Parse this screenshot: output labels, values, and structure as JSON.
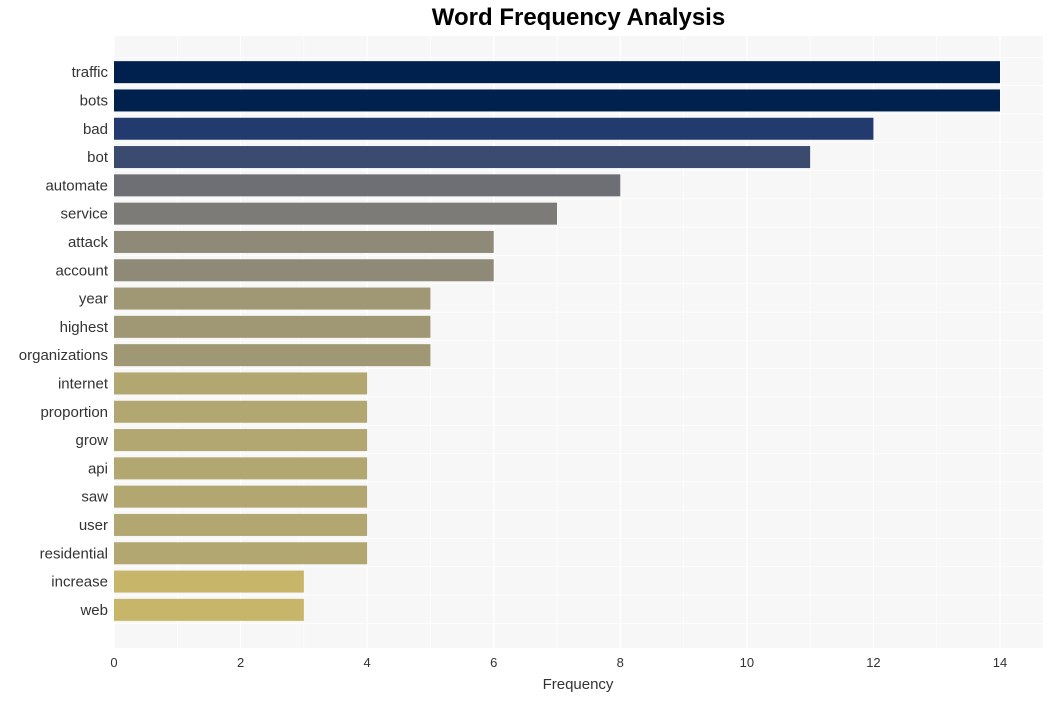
{
  "chart_data": {
    "type": "bar",
    "orientation": "horizontal",
    "title": "Word Frequency Analysis",
    "xlabel": "Frequency",
    "ylabel": "",
    "xlim": [
      0,
      14.7
    ],
    "xticks": [
      0,
      2,
      4,
      6,
      8,
      10,
      12,
      14
    ],
    "grid": true,
    "legend": "none",
    "categories": [
      "traffic",
      "bots",
      "bad",
      "bot",
      "automate",
      "service",
      "attack",
      "account",
      "year",
      "highest",
      "organizations",
      "internet",
      "proportion",
      "grow",
      "api",
      "saw",
      "user",
      "residential",
      "increase",
      "web"
    ],
    "values": [
      14,
      14,
      12,
      11,
      8,
      7,
      6,
      6,
      5,
      5,
      5,
      4,
      4,
      4,
      4,
      4,
      4,
      4,
      3,
      3
    ],
    "colors": [
      "#00204e",
      "#00204e",
      "#233a6e",
      "#3b4a6f",
      "#6d6f75",
      "#7d7b78",
      "#8f8a78",
      "#8f8a78",
      "#a09775",
      "#a09775",
      "#a09775",
      "#b2a671",
      "#b2a671",
      "#b2a671",
      "#b2a671",
      "#b2a671",
      "#b2a671",
      "#b2a671",
      "#c7b56a",
      "#c7b56a"
    ]
  }
}
